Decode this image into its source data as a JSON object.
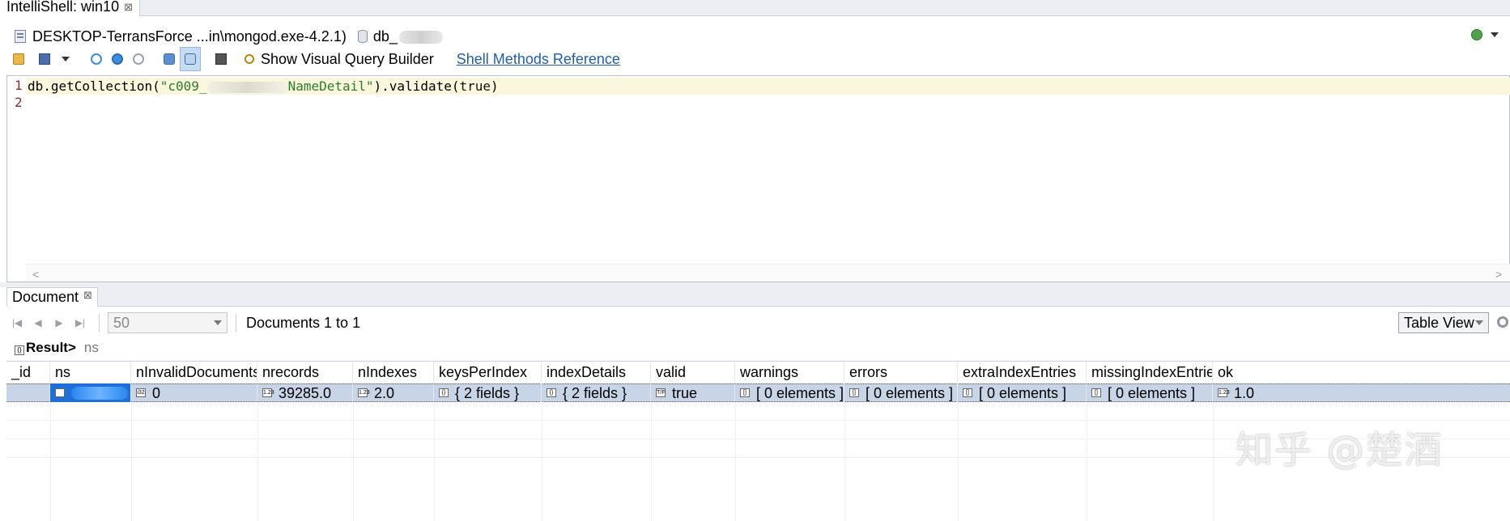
{
  "window_tab": {
    "title": "IntelliShell: win10",
    "close_glyph": "⊠"
  },
  "connection": {
    "server": "DESKTOP-TerransForce ...in\\mongod.exe-4.2.1)",
    "database": "db_"
  },
  "toolbar": {
    "visual_query_builder_label": "Show Visual Query Builder",
    "shell_methods_reference_label": "Shell Methods Reference"
  },
  "editor": {
    "line_numbers": [
      "1",
      "2"
    ],
    "code": {
      "prefix": "db.getCollection(",
      "string_start": "\"c009_",
      "string_end": "NameDetail\"",
      "suffix": ").validate(",
      "arg": "true",
      "close": ")"
    }
  },
  "result_panel": {
    "tab_label": "Document",
    "tab_close_glyph": "⊠",
    "page_size": "50",
    "documents_range": "Documents 1 to 1",
    "view_mode": "Table View",
    "result_label": "Result>",
    "result_ns": "ns"
  },
  "table": {
    "columns": [
      "_id",
      "ns",
      "nInvalidDocuments",
      "nrecords",
      "nIndexes",
      "keysPerIndex",
      "indexDetails",
      "valid",
      "warnings",
      "errors",
      "extraIndexEntries",
      "missingIndexEntries",
      "ok"
    ],
    "row": {
      "id": "",
      "nInvalidDocuments": "0",
      "nrecords": "39285.0",
      "nIndexes": "2.0",
      "keysPerIndex": "{ 2 fields }",
      "indexDetails": "{ 2 fields }",
      "valid": "true",
      "warnings": "[ 0 elements ]",
      "errors": "[ 0 elements ]",
      "extraIndexEntries": "[ 0 elements ]",
      "missingIndexEntries": "[ 0 elements ]",
      "ok": "1.0"
    },
    "type_icons": {
      "int": "i32",
      "double": "1.23",
      "object": "{}",
      "bool": "T/F",
      "array": "[]"
    }
  },
  "watermark": "知乎 @楚酒",
  "colors": {
    "selection": "#1e6fd9",
    "row_highlight": "#c7d5e6",
    "link": "#1f5fad",
    "string": "#2a7d2a"
  }
}
